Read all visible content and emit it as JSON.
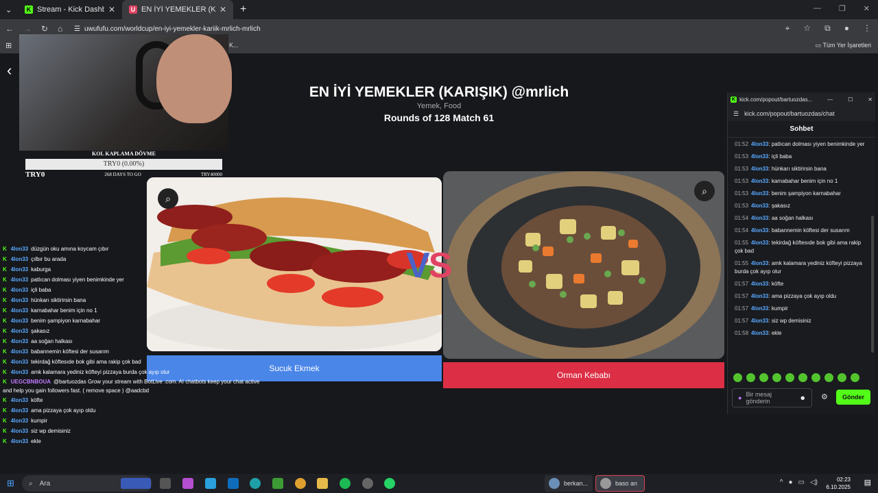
{
  "browser": {
    "tabs": [
      {
        "label": "Stream - Kick Dashboard",
        "favicon": "K",
        "favcolor": "#53fc18"
      },
      {
        "label": "EN İYİ YEMEKLER (KARIŞIK) @m",
        "favicon": "U",
        "favcolor": "#e04363"
      }
    ],
    "url": "uwufufu.com/worldcup/en-iyi-yemekler-kariik-mrlich-mrlich",
    "bookmarks_label": "Tüm Yer İşaretleri",
    "bm_partial": "K..."
  },
  "page": {
    "title": "EN İYİ YEMEKLER (KARIŞIK) @mrlich",
    "subtitle": "Yemek, Food",
    "rounds": "Rounds of 128 Match 61",
    "left_choice": "Sucuk Ekmek",
    "right_choice": "Orman Kebabı",
    "vs_v": "V",
    "vs_s": "S"
  },
  "goal": {
    "title": "KOL KAPLAMA DÖVME",
    "progress": "TRY0 (0.00%)",
    "current": "TRY0",
    "days": "268 DAYS TO GO",
    "target": "TRY40000"
  },
  "left_chat": [
    {
      "user": "4lon33",
      "text": "düzgün oku amına koycam çıbır"
    },
    {
      "user": "4lon33",
      "text": "çılbır bu arada"
    },
    {
      "user": "4lon33",
      "text": "kaburga"
    },
    {
      "user": "4lon33",
      "text": "patlıcan dolması yiyen benimkinde yer"
    },
    {
      "user": "4lon33",
      "text": "içli baba"
    },
    {
      "user": "4lon33",
      "text": "hünkarı siktirirsin bana"
    },
    {
      "user": "4lon33",
      "text": "karnabahar benim için no 1"
    },
    {
      "user": "4lon33",
      "text": "benim şampiyon karnabahar"
    },
    {
      "user": "4lon33",
      "text": "şakasız"
    },
    {
      "user": "4lon33",
      "text": "aa soğan halkası"
    },
    {
      "user": "4lon33",
      "text": "babannemin köftesi der susarım"
    },
    {
      "user": "4lon33",
      "text": "tekirdağ köftesıde bok gibi ama rakip çok bad"
    },
    {
      "user": "4lon33",
      "text": "amk kalamara yediniz köfteyi pizzaya burda çok ayıp olur"
    }
  ],
  "bot_msg": {
    "user": "UEGCBNBOUA",
    "line1": "@bartuozdas Grow your stream with BotLive .com. AI chatbots keep your chat active",
    "line2": "and help you gain followers fast. ( remove space ) @aadcbd"
  },
  "left_chat2": [
    {
      "user": "4lon33",
      "text": "köfte"
    },
    {
      "user": "4lon33",
      "text": "ama pizzaya çok ayıp oldu"
    },
    {
      "user": "4lon33",
      "text": "kumpir"
    },
    {
      "user": "4lon33",
      "text": "siz wp demisiniz"
    },
    {
      "user": "4lon33",
      "text": "ekle"
    }
  ],
  "popout": {
    "title": "kick.com/popout/bartuozdas...",
    "url": "kick.com/popout/bartuozdas/chat",
    "header": "Sohbet",
    "messages": [
      {
        "ts": "01:52",
        "user": "4lon33",
        "text": ": patlıcan dolması yiyen benimkinde yer"
      },
      {
        "ts": "01:53",
        "user": "4lon33",
        "text": ": içli baba"
      },
      {
        "ts": "01:53",
        "user": "4lon33",
        "text": ": hünkarı siktirirsin bana"
      },
      {
        "ts": "01:53",
        "user": "4lon33",
        "text": ": karnabahar benim için no 1"
      },
      {
        "ts": "01:53",
        "user": "4lon33",
        "text": ": benim şampiyon karnabahar"
      },
      {
        "ts": "01:53",
        "user": "4lon33",
        "text": ": şakasız"
      },
      {
        "ts": "01:54",
        "user": "4lon33",
        "text": ": aa soğan halkası"
      },
      {
        "ts": "01:54",
        "user": "4lon33",
        "text": ": babannemin köftesi der susarım"
      },
      {
        "ts": "01:55",
        "user": "4lon33",
        "text": ": tekirdağ köftesıde bok gibi ama rakip çok bad"
      },
      {
        "ts": "01:55",
        "user": "4lon33",
        "text": ": amk kalamara yediniz köfteyi pizzaya burda çok ayıp olur"
      },
      {
        "ts": "01:57",
        "user": "4lon33",
        "text": ": köfte"
      },
      {
        "ts": "01:57",
        "user": "4lon33",
        "text": ": ama pizzaya çok ayıp oldu"
      },
      {
        "ts": "01:57",
        "user": "4lon33",
        "text": ": kumpir"
      },
      {
        "ts": "01:57",
        "user": "4lon33",
        "text": ": siz wp demisiniz"
      },
      {
        "ts": "01:58",
        "user": "4lon33",
        "text": ": ekle"
      }
    ],
    "placeholder": "Bir mesaj gönderin",
    "send_label": "Gönder"
  },
  "taskbar": {
    "search_placeholder": "Ara",
    "app1": "berkan...",
    "app2": "baso an",
    "time": "02:23",
    "date": "6.10.2025"
  }
}
